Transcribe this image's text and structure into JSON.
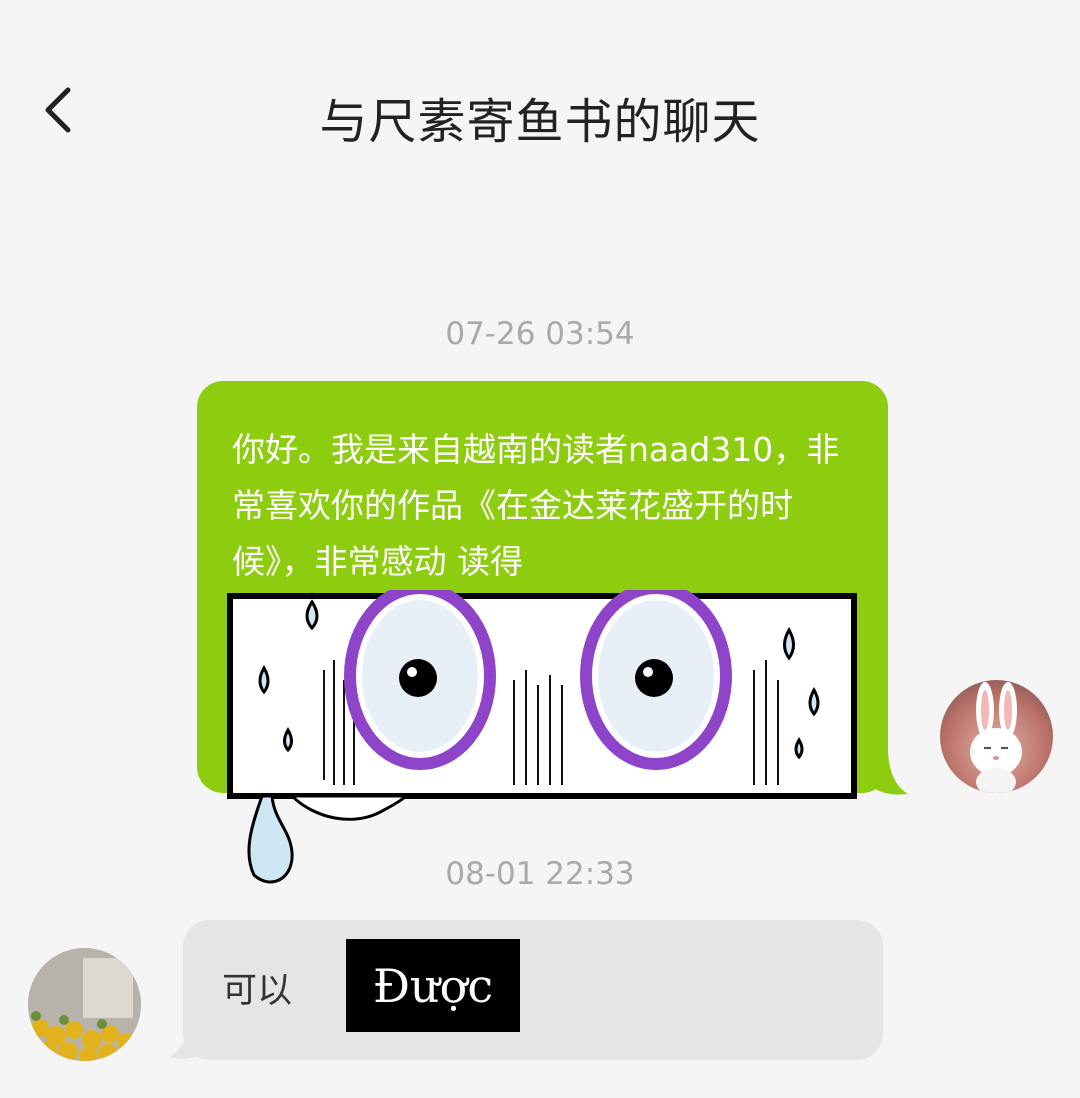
{
  "header": {
    "title": "与尺素寄鱼书的聊天"
  },
  "messages": [
    {
      "timestamp": "07-26 03:54",
      "direction": "outgoing",
      "text": "你好。我是来自越南的读者naad310，非常喜欢你的作品《在金达莱花盛开的时候》，非常感动 读得",
      "sticker": "crying-eyes-sticker"
    },
    {
      "timestamp": "08-01 22:33",
      "direction": "incoming",
      "text": "可以",
      "translation": "Được"
    }
  ],
  "colors": {
    "outgoing_bubble": "#8ecc10",
    "incoming_bubble": "#e5e5e5",
    "background": "#f5f5f5",
    "timestamp": "#a9a9a9"
  }
}
